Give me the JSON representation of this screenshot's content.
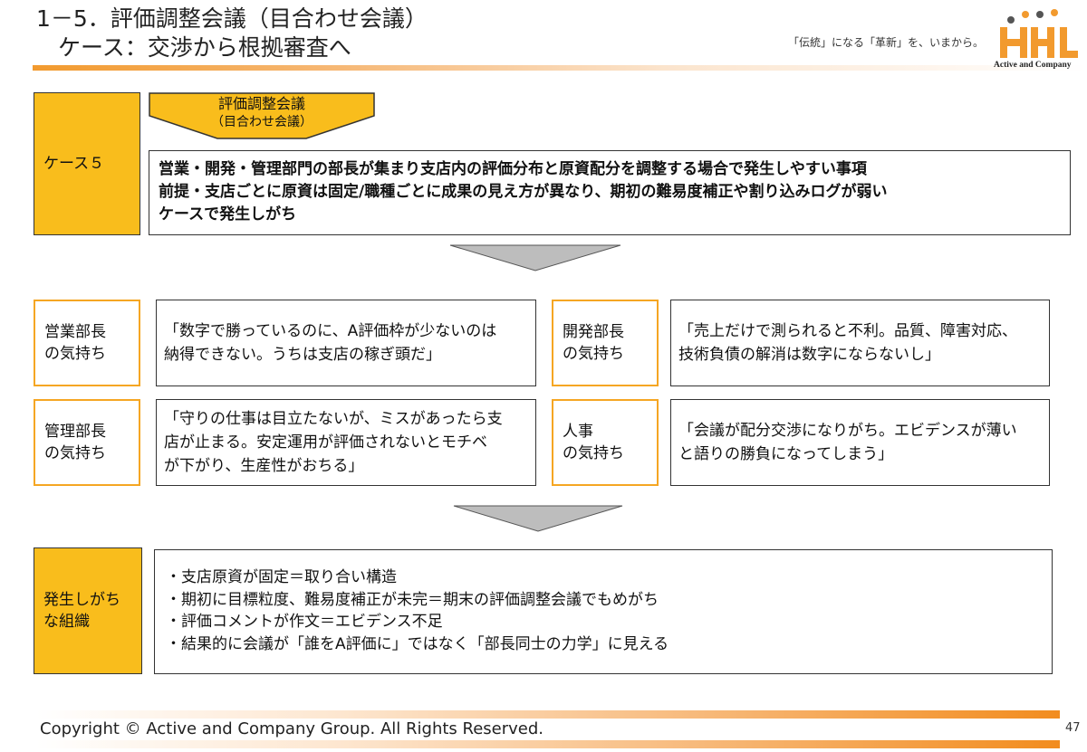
{
  "header": {
    "title_line1": "1－5．評価調整会議（目合わせ会議）",
    "title_line2": "ケース：交渉から根拠審査へ",
    "tagline": "「伝統」になる「革新」を、いまから。",
    "logo_text": "Active and Company",
    "accent_color": "#f29a2e"
  },
  "case": {
    "label": "ケース５",
    "chevron_title": "評価調整会議",
    "chevron_subtitle": "（目合わせ会議）",
    "lines": [
      "営業・開発・管理部門の部長が集まり支店内の評価分布と原資配分を調整する場合で発生しやすい事項",
      "前提・支店ごとに原資は固定/職種ごとに成果の見え方が異なり、期初の難易度補正や割り込みログが弱い",
      "ケースで発生しがち"
    ]
  },
  "feelings": [
    {
      "label_lines": [
        "営業部長",
        "の気持ち"
      ],
      "quote_lines": [
        "「数字で勝っているのに、A評価枠が少ないのは",
        "納得できない。うちは支店の稼ぎ頭だ」"
      ]
    },
    {
      "label_lines": [
        "開発部長",
        "の気持ち"
      ],
      "quote_lines": [
        "「売上だけで測られると不利。品質、障害対応、",
        "技術負債の解消は数字にならないし」"
      ]
    },
    {
      "label_lines": [
        "管理部長",
        "の気持ち"
      ],
      "quote_lines": [
        "「守りの仕事は目立たないが、ミスがあったら支",
        "店が止まる。安定運用が評価されないとモチベ",
        "が下がり、生産性がおちる」"
      ]
    },
    {
      "label_lines": [
        "人事",
        "の気持ち"
      ],
      "quote_lines": [
        "「会議が配分交渉になりがち。エビデンスが薄い",
        "と語りの勝負になってしまう」"
      ]
    }
  ],
  "organization": {
    "label_lines": [
      "発生しがち",
      "な組織"
    ],
    "bullets": [
      "・支店原資が固定＝取り合い構造",
      "・期初に目標粒度、難易度補正が未完＝期末の評価調整会議でもめがち",
      "・評価コメントが作文＝エビデンス不足",
      "・結果的に会議が「誰をA評価に」ではなく「部長同士の力学」に見える"
    ]
  },
  "footer": {
    "copyright": "Copyright © Active and Company Group. All Rights Reserved.",
    "page_number": "47"
  }
}
